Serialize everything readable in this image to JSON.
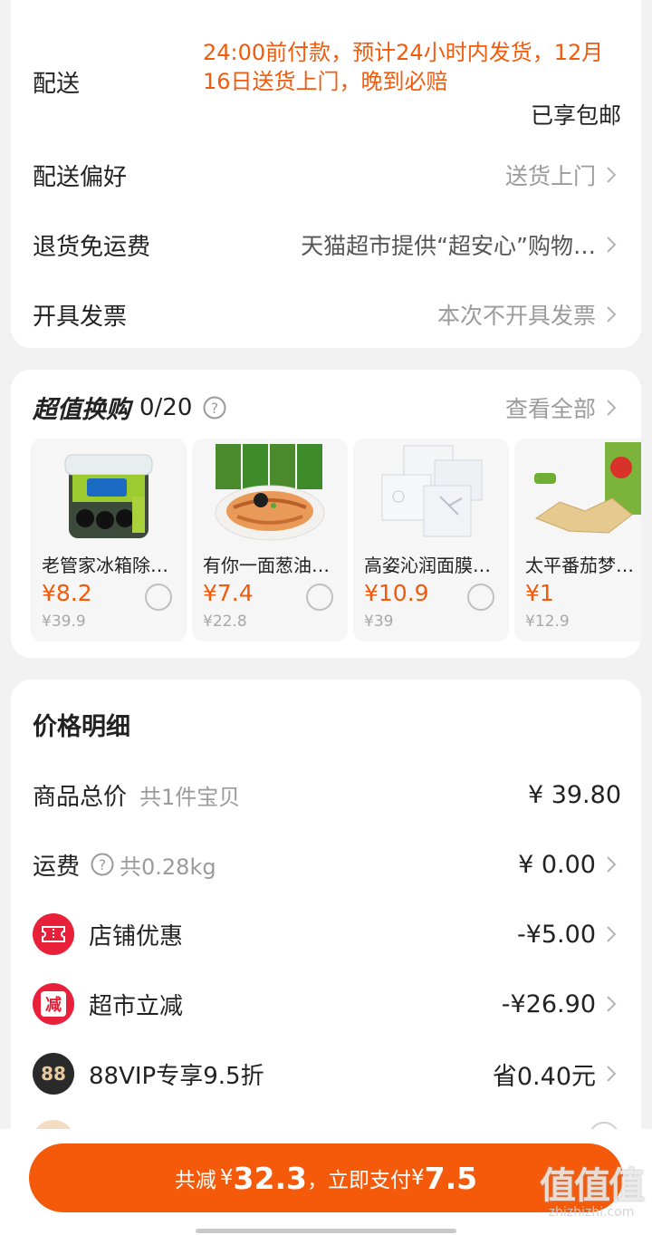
{
  "delivery": {
    "label": "配送",
    "text": "24:00前付款，预计24小时内发货，12月16日送货上门，晚到必赔",
    "free_shipping": "已享包邮",
    "rows": [
      {
        "label": "配送偏好",
        "value": "送货上门"
      },
      {
        "label": "退货免运费",
        "value": "天猫超市提供“超安心”购物…"
      },
      {
        "label": "开具发票",
        "value": "本次不开具发票"
      }
    ]
  },
  "trade_up": {
    "brand": "超值换购",
    "count": "0/20",
    "view_all": "查看全部",
    "products": [
      {
        "name": "老管家冰箱除…",
        "price": "¥8.2",
        "original": "¥39.9",
        "icon": "fridge-deodorizer-box"
      },
      {
        "name": "有你一面葱油…",
        "price": "¥7.4",
        "original": "¥22.8",
        "icon": "scallion-oil-noodles"
      },
      {
        "name": "高姿沁润面膜…",
        "price": "¥10.9",
        "original": "¥39",
        "icon": "face-mask-packs"
      },
      {
        "name": "太平番茄梦…",
        "price": "¥1",
        "original": "¥12.9",
        "icon": "tomato-crackers"
      }
    ]
  },
  "price_detail": {
    "title": "价格明细",
    "total": {
      "label": "商品总价",
      "sub": "共1件宝贝",
      "value": "¥ 39.80"
    },
    "shipping": {
      "label": "运费",
      "sub": "共0.28kg",
      "value": "¥ 0.00"
    },
    "discounts": [
      {
        "label": "店铺优惠",
        "value": "-¥5.00",
        "icon": "coupon-ticket-icon"
      },
      {
        "label": "超市立减",
        "value": "-¥26.90",
        "icon": "instant-reduction-icon",
        "badge_text": "减"
      },
      {
        "label": "88VIP专享9.5折",
        "value": "省0.40元",
        "icon": "88vip-icon",
        "badge_text": "88"
      }
    ]
  },
  "bottom": {
    "pay_prefix": "共减",
    "pay_cur1": "¥",
    "pay_amount1": "32.3",
    "pay_mid": "，立即支付",
    "pay_cur2": "¥",
    "pay_amount2": "7.5",
    "watermark_glyph": "值值值",
    "watermark_url": "zhizhizhi.com"
  },
  "colors": {
    "accent": "#f25a0c",
    "button": "#f55a0a",
    "coupon_badge": "#e8203a",
    "vip_badge": "#2a2a2a"
  }
}
